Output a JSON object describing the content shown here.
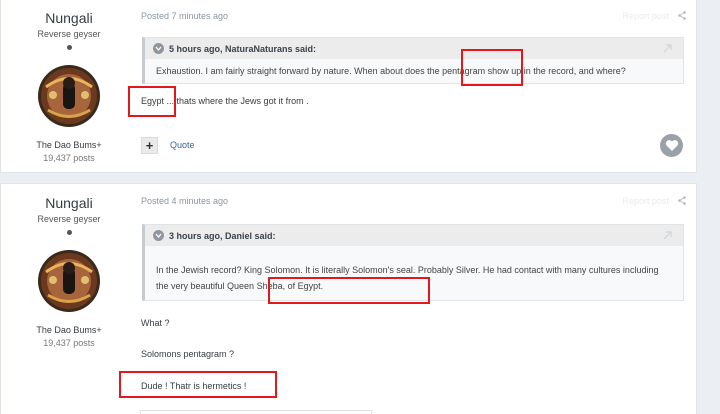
{
  "posts": [
    {
      "author": {
        "name": "Nungali",
        "title": "Reverse geyser",
        "group": "The Dao Bums+",
        "postcount": "19,437 posts"
      },
      "meta": "Posted 7 minutes ago",
      "report_label": "Report post",
      "quote": {
        "header": "5 hours ago, NaturaNaturans said:",
        "body": "Exhaustion. I am fairly straight forward by nature. When about does the pentagram show up in the record, and where?"
      },
      "paragraphs": [
        "Egypt ...  thats where the Jews got it from ."
      ],
      "quote_button_label": "Quote"
    },
    {
      "author": {
        "name": "Nungali",
        "title": "Reverse geyser",
        "group": "The Dao Bums+",
        "postcount": "19,437 posts"
      },
      "meta": "Posted 4 minutes ago",
      "report_label": "Report post",
      "quote": {
        "header": "3 hours ago, Daniel said:",
        "body": "In the Jewish record?  King Solomon.  It is literally Solomon's seal.  Probably Silver.  He had contact with many cultures including the very beautiful Queen Sheba, of Egypt."
      },
      "paragraphs": [
        "What ?",
        "Solomons pentagram ?",
        "Dude !  Thatr is hermetics !"
      ]
    }
  ],
  "colors": {
    "highlight": "#e3171c",
    "link": "#3d6594",
    "meta": "#8a96a3"
  },
  "icons": [
    "quote-icon",
    "share-icon",
    "arrow-up-right-icon",
    "plus-icon",
    "heart-icon"
  ]
}
